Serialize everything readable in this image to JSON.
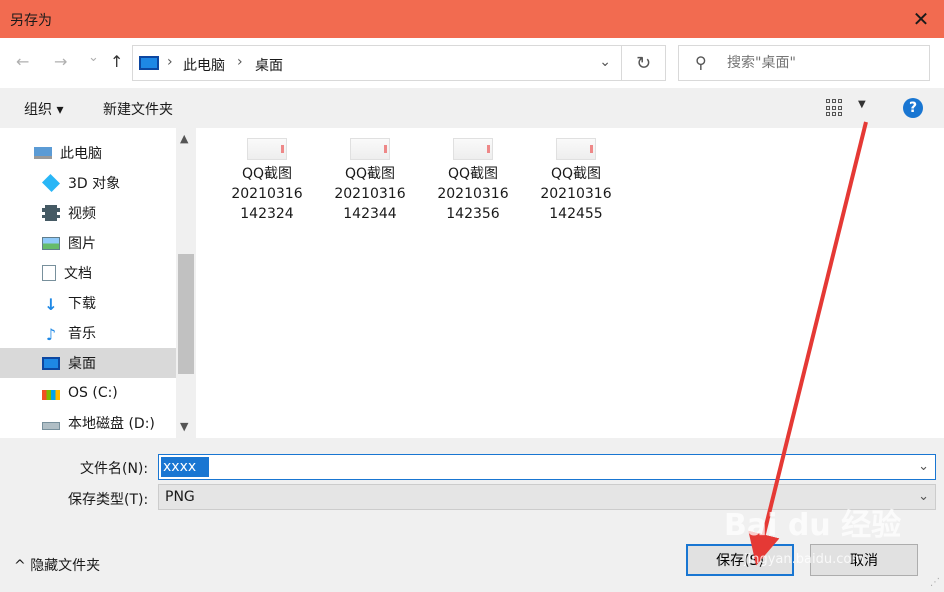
{
  "window": {
    "title": "另存为",
    "close_glyph": "✕"
  },
  "nav": {
    "back_glyph": "←",
    "forward_glyph": "→",
    "history_glyph": "⌄",
    "up_glyph": "↑",
    "breadcrumb": [
      "此电脑",
      "桌面"
    ],
    "refresh_glyph": "↻",
    "search_placeholder": "搜索\"桌面\""
  },
  "toolbar": {
    "organize_label": "组织 ▾",
    "new_folder_label": "新建文件夹",
    "help_label": "?"
  },
  "sidebar": {
    "items": [
      {
        "label": "此电脑",
        "icon": "computer-icon",
        "selected": false
      },
      {
        "label": "3D 对象",
        "icon": "cube-icon",
        "selected": false
      },
      {
        "label": "视频",
        "icon": "film-icon",
        "selected": false
      },
      {
        "label": "图片",
        "icon": "picture-icon",
        "selected": false
      },
      {
        "label": "文档",
        "icon": "document-icon",
        "selected": false
      },
      {
        "label": "下载",
        "icon": "download-icon",
        "selected": false
      },
      {
        "label": "音乐",
        "icon": "music-icon",
        "selected": false
      },
      {
        "label": "桌面",
        "icon": "desktop-icon",
        "selected": true
      },
      {
        "label": "OS (C:)",
        "icon": "drive-icon",
        "selected": false
      },
      {
        "label": "本地磁盘 (D:)",
        "icon": "disk-icon",
        "selected": false
      }
    ]
  },
  "files": [
    {
      "name": "QQ截图\n20210316\n142324"
    },
    {
      "name": "QQ截图\n20210316\n142344"
    },
    {
      "name": "QQ截图\n20210316\n142356"
    },
    {
      "name": "QQ截图\n20210316\n142455"
    }
  ],
  "form": {
    "filename_label": "文件名(N):",
    "filename_value": "xxxx",
    "filetype_label": "保存类型(T):",
    "filetype_value": "PNG"
  },
  "footer": {
    "hide_folders_label": "隐藏文件夹",
    "save_label": "保存(S)",
    "cancel_label": "取消"
  },
  "watermark": {
    "brand": "Bai du 经验",
    "url": "jingyan.baidu.com"
  },
  "colors": {
    "titlebar": "#f26b50",
    "accent": "#1976d2",
    "annotation_arrow": "#e53935"
  }
}
